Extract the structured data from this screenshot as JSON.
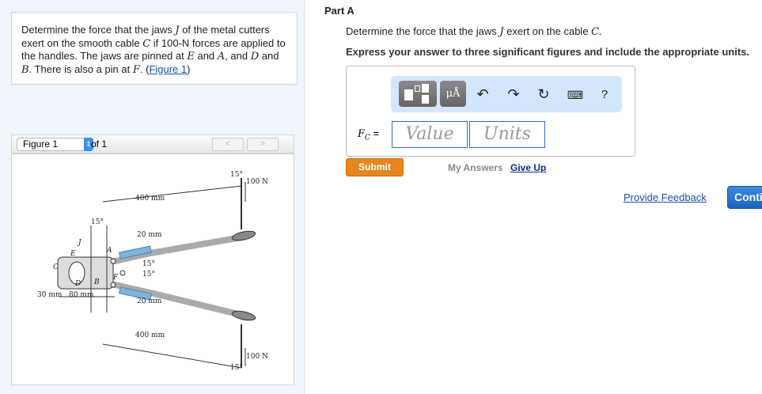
{
  "problem": {
    "text_1": "Determine the force that the jaws ",
    "J": "J",
    "text_2": " of the metal cutters exert on the smooth cable ",
    "C": "C",
    "text_3": " if 100-",
    "N": "N",
    "text_4": " forces are applied to the handles. The jaws are pinned at ",
    "E": "E",
    "text_5": " and ",
    "A": "A",
    "text_6": ", and ",
    "D": "D",
    "text_7": " and ",
    "B": "B",
    "text_8": ". There is also a pin at ",
    "F": "F",
    "text_9": ". (",
    "link": "Figure 1",
    "text_10": ")"
  },
  "figure": {
    "select": "Figure 1",
    "of": "of 1",
    "prev": "<",
    "next": ">",
    "labels": {
      "top_angle": "15°",
      "top_force": "100 N",
      "top_len": "400 mm",
      "angle_15": "15°",
      "top_20": "20 mm",
      "J": "J",
      "A": "A",
      "E": "E",
      "C": "C",
      "ang_a": "15°",
      "ang_b": "15°",
      "F": "F",
      "D": "D",
      "B": "B",
      "d30": "30 mm",
      "d80": "80 mm",
      "bot_20": "20 mm",
      "bot_len": "400 mm",
      "bot_force": "100 N",
      "bot_angle": "15°"
    }
  },
  "part": {
    "title": "Part A",
    "q1": "Determine the force that the jaws ",
    "qJ": "J",
    "q2": " exert on the cable ",
    "qC": "C",
    "q3": ".",
    "instruction": "Express your answer to three significant figures and include the appropriate units."
  },
  "toolbar": {
    "units_btn": "μÅ",
    "help": "?"
  },
  "answer": {
    "label_F": "F",
    "label_sub": "C",
    "eq": " =",
    "value_placeholder": "Value",
    "units_placeholder": "Units"
  },
  "actions": {
    "submit": "Submit",
    "my_answers": "My Answers",
    "give_up": "Give Up",
    "feedback": "Provide Feedback",
    "continue": "Continue"
  },
  "colors": {
    "submit": "#e8861e",
    "link": "#1a4ea8",
    "toolbar": "#d3e6fb"
  }
}
